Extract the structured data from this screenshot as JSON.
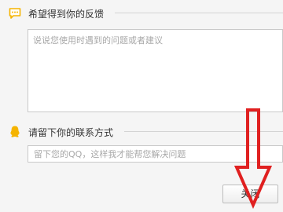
{
  "feedback": {
    "title": "希望得到你的反馈",
    "placeholder": "说说您使用时遇到的问题或者建议",
    "icon": "chat-bubble-icon",
    "icon_color": "#f5b400"
  },
  "contact": {
    "title": "请留下你的联系方式",
    "placeholder": "留下您的QQ，这样我才能帮您解决问题",
    "icon": "qq-penguin-icon",
    "icon_color": "#f5b400"
  },
  "close_button": {
    "label": "关闭"
  },
  "annotation": {
    "icon": "red-down-arrow-icon",
    "color": "#e02020"
  }
}
